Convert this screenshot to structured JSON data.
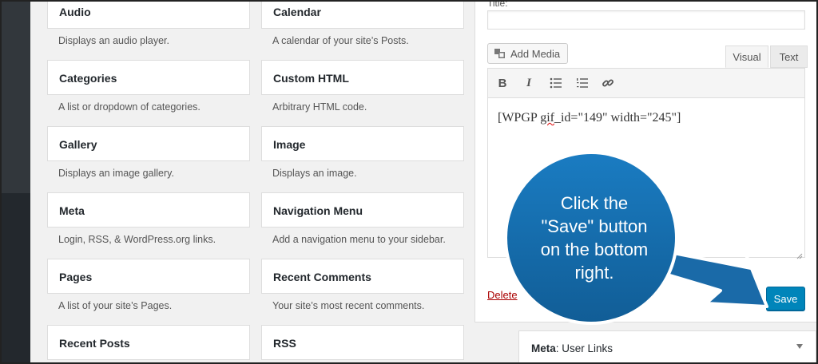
{
  "widgets": {
    "left": [
      {
        "title": "Audio",
        "desc": "Displays an audio player."
      },
      {
        "title": "Categories",
        "desc": "A list or dropdown of categories."
      },
      {
        "title": "Gallery",
        "desc": "Displays an image gallery."
      },
      {
        "title": "Meta",
        "desc": "Login, RSS, & WordPress.org links."
      },
      {
        "title": "Pages",
        "desc": "A list of your site’s Pages."
      },
      {
        "title": "Recent Posts",
        "desc": ""
      }
    ],
    "right": [
      {
        "title": "Calendar",
        "desc": "A calendar of your site’s Posts."
      },
      {
        "title": "Custom HTML",
        "desc": "Arbitrary HTML code."
      },
      {
        "title": "Image",
        "desc": "Displays an image."
      },
      {
        "title": "Navigation Menu",
        "desc": "Add a navigation menu to your sidebar."
      },
      {
        "title": "Recent Comments",
        "desc": "Your site’s most recent comments."
      },
      {
        "title": "RSS",
        "desc": ""
      }
    ]
  },
  "editor_panel": {
    "title_label": "Title:",
    "title_value": "",
    "add_media_label": "Add Media",
    "tabs": {
      "visual": "Visual",
      "text": "Text"
    },
    "toolbar": {
      "bold": "B",
      "italic": "I"
    },
    "content_prefix": "[WPGP ",
    "content_squiggle": "gif",
    "content_suffix": "_id=\"149\" width=\"245\"]",
    "delete_label": "Delete",
    "save_label": "Save"
  },
  "meta_widget": {
    "prefix": "Meta",
    "suffix": ": User Links"
  },
  "callout": {
    "line1": "Click the",
    "line2": "\"Save\" button",
    "line3": "on the bottom",
    "line4": "right.",
    "color": "#1570b3"
  }
}
